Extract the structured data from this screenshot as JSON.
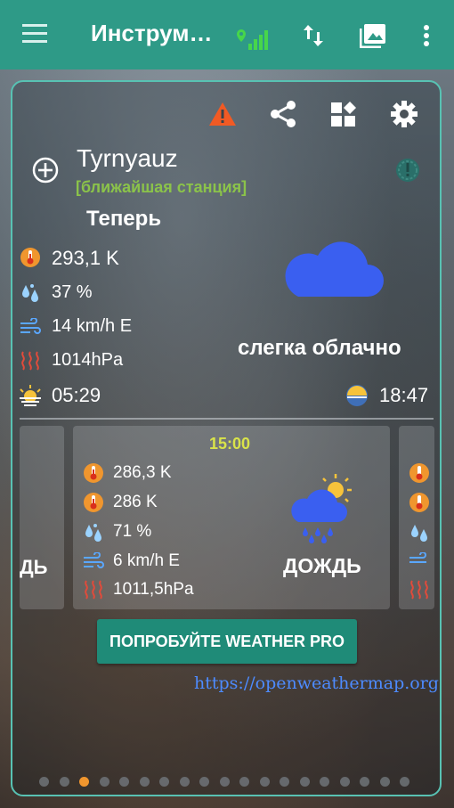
{
  "app": {
    "title": "Инструм…",
    "icons": [
      "menu-icon",
      "signal-icon",
      "swap-vert-icon",
      "image-icon",
      "more-vert-icon"
    ]
  },
  "toolbar_icons": [
    "warning-icon",
    "share-icon",
    "widgets-icon",
    "settings-icon"
  ],
  "location": {
    "city": "Tyrnyauz",
    "station": "[ближайшая станция]"
  },
  "current": {
    "heading": "Теперь",
    "temperature": "293,1 K",
    "humidity": "37 %",
    "wind": "14 km/h E",
    "pressure": "1014hPa",
    "sunrise": "05:29",
    "sunset": "18:47",
    "condition": "слегка облачно"
  },
  "forecast": {
    "left_partial": {
      "condition_tail": "ДЬ"
    },
    "card": {
      "time": "15:00",
      "temp": "286,3 K",
      "temp_feel": "286 K",
      "humidity": "71 %",
      "wind": "6 km/h E",
      "pressure": "1011,5hPa",
      "condition": "ДОЖДЬ"
    }
  },
  "promo_button": "ПОПРОБУЙТЕ WEATHER PRO",
  "source_link": "https://openweathermap.org",
  "pager": {
    "count": 19,
    "active_index": 2
  },
  "colors": {
    "primary": "#2e9a87",
    "accent": "#58c2b3",
    "warning": "#f15a24",
    "cloud": "#3a5ff0",
    "time_label": "#d9e34a",
    "station_label": "#8bc34a"
  }
}
